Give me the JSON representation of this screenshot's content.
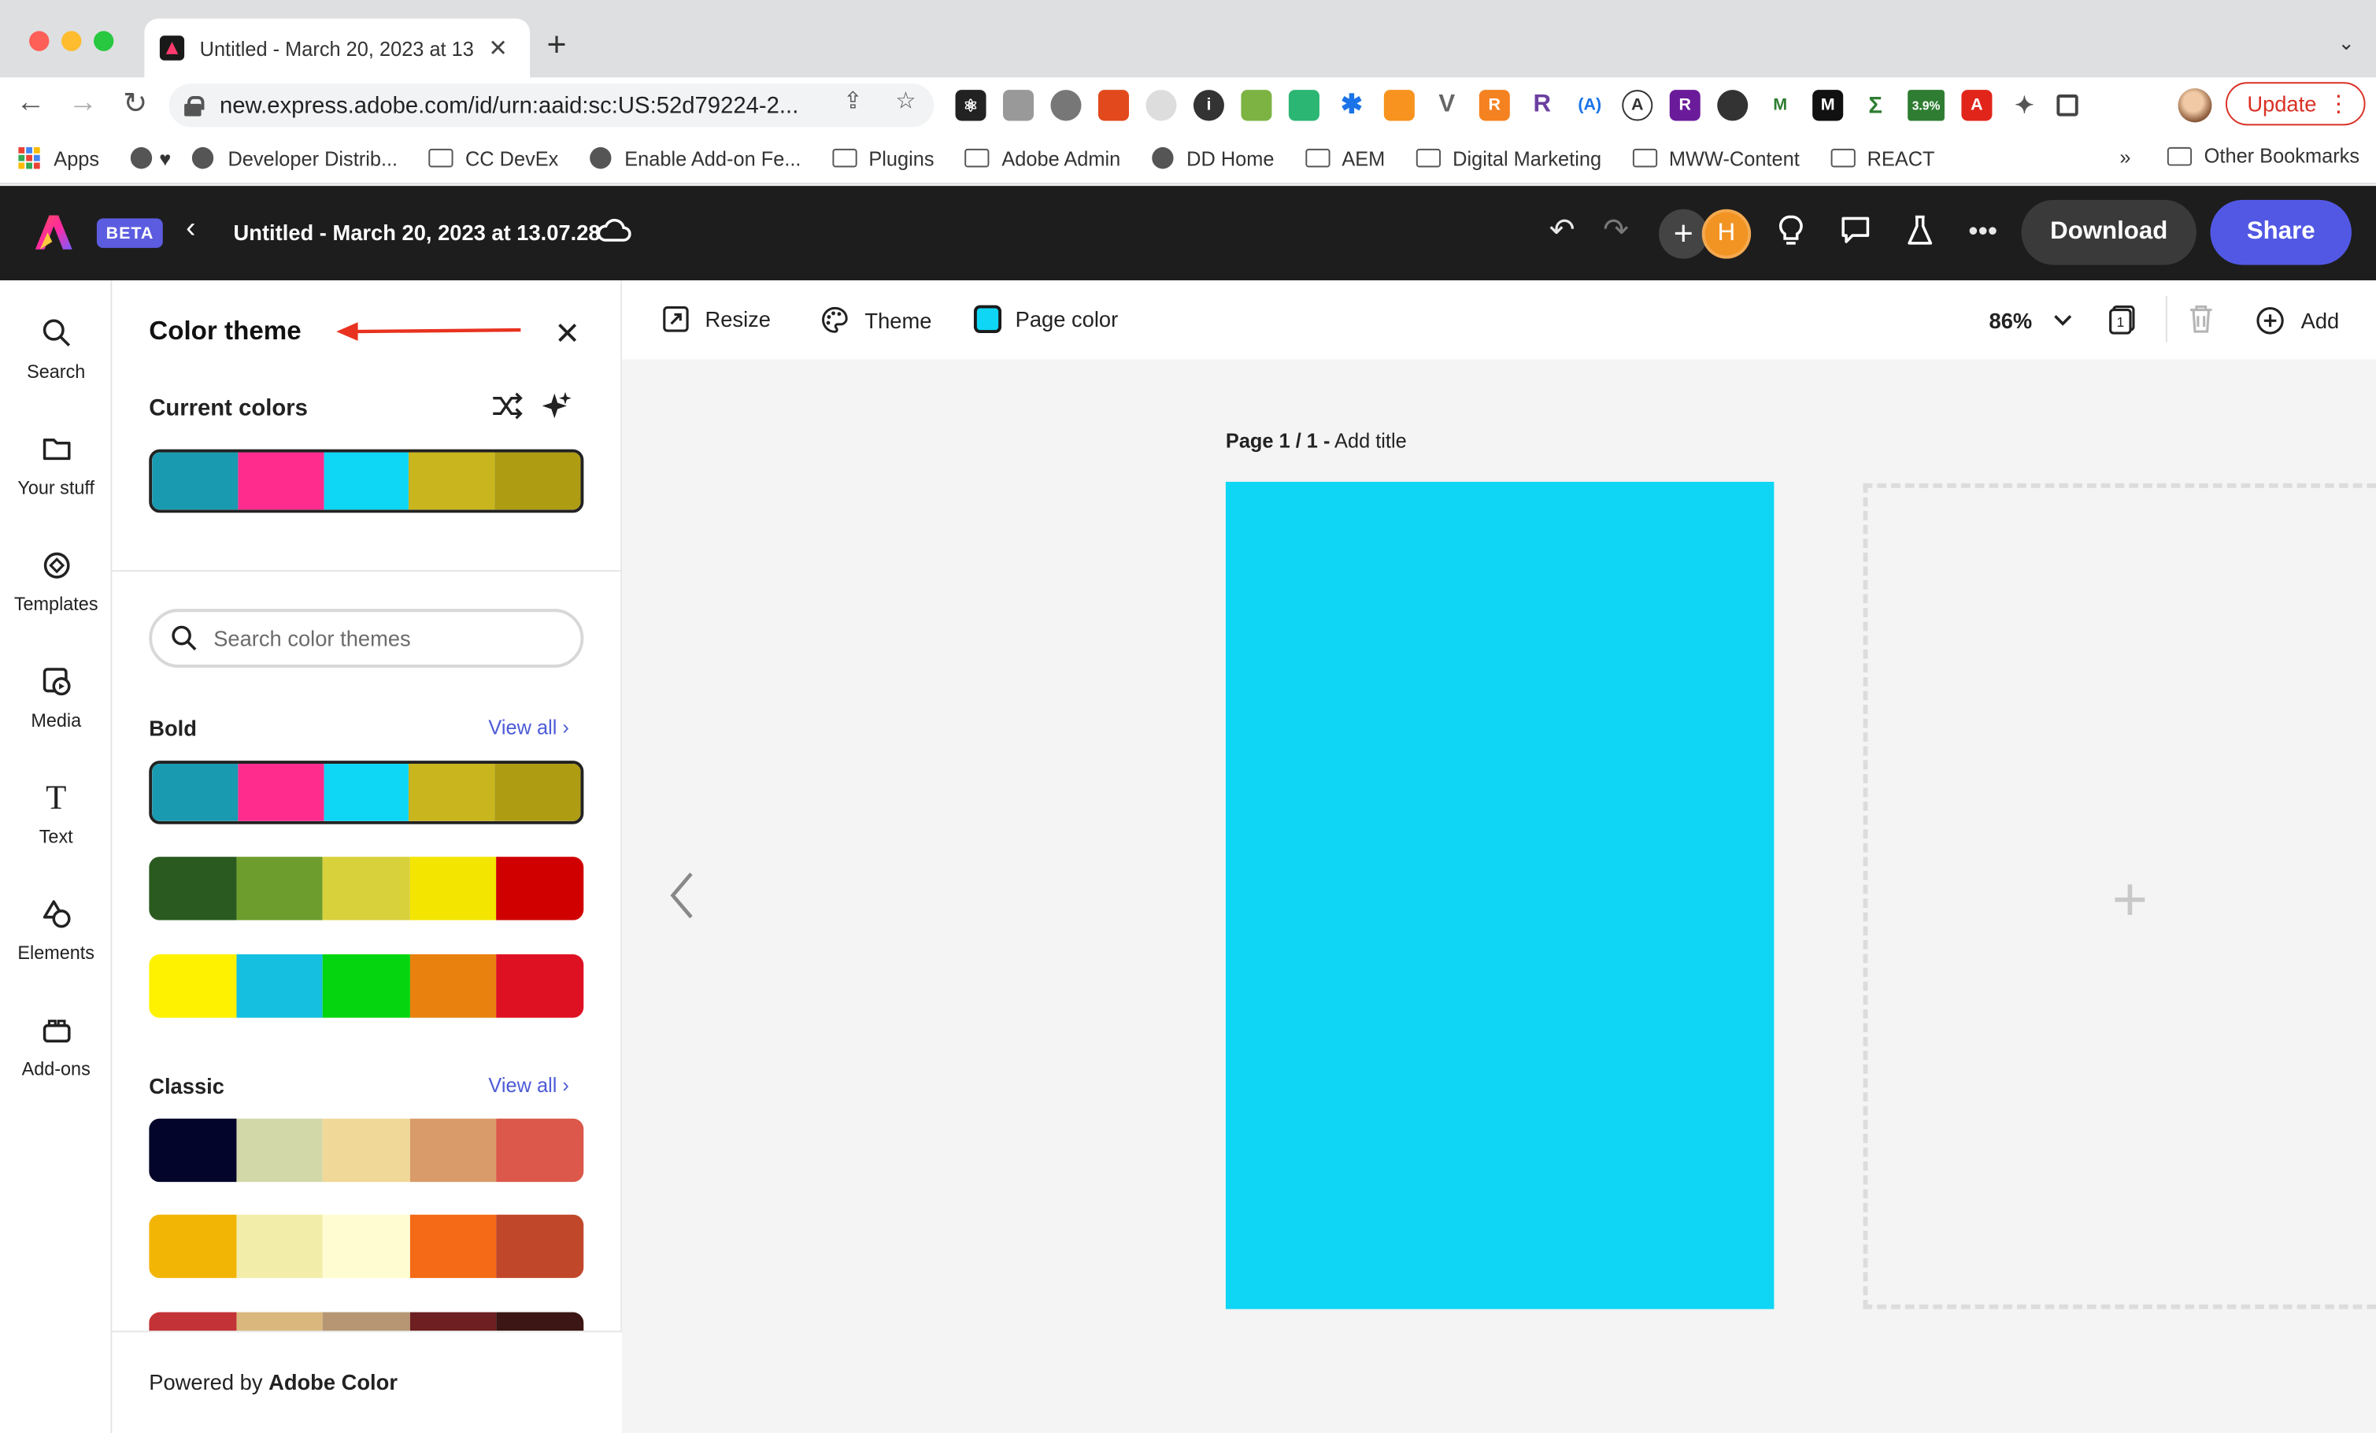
{
  "browser": {
    "tab_title": "Untitled - March 20, 2023 at 13",
    "url": "new.express.adobe.com/id/urn:aaid:sc:US:52d79224-2...",
    "update_label": "Update",
    "ext_badge": "3.9%",
    "bookmarks": [
      "Apps",
      "Developer Distrib...",
      "CC DevEx",
      "Enable Add-on Fe...",
      "Plugins",
      "Adobe Admin",
      "DD Home",
      "AEM",
      "Digital Marketing",
      "MWW-Content",
      "REACT"
    ],
    "bookmarks_more": "»",
    "other_bookmarks": "Other Bookmarks"
  },
  "app": {
    "beta": "BETA",
    "doc_title": "Untitled - March 20, 2023 at 13.07.28",
    "user_initial": "H",
    "download": "Download",
    "share": "Share"
  },
  "rail": {
    "items": [
      "Search",
      "Your stuff",
      "Templates",
      "Media",
      "Text",
      "Elements",
      "Add-ons"
    ]
  },
  "panel": {
    "title": "Color theme",
    "current_label": "Current colors",
    "current_colors": [
      "#1a9ab0",
      "#ff2c8e",
      "#0ed6f5",
      "#c9b51d",
      "#ae9c13"
    ],
    "search_placeholder": "Search color themes",
    "bold_label": "Bold",
    "classic_label": "Classic",
    "view_all": "View all",
    "bold_themes": [
      [
        "#1a9ab0",
        "#ff2c8e",
        "#0ed6f5",
        "#c9b51d",
        "#ae9c13"
      ],
      [
        "#2a5a1f",
        "#6d9d2c",
        "#d9d13c",
        "#f4e500",
        "#d00000"
      ],
      [
        "#fff200",
        "#14bfe0",
        "#05d50e",
        "#e8810d",
        "#de1122"
      ]
    ],
    "classic_themes": [
      [
        "#03062a",
        "#d3d8a9",
        "#f0d898",
        "#d99b6a",
        "#db584a"
      ],
      [
        "#f2b506",
        "#f2eda9",
        "#fffcd2",
        "#f46a16",
        "#c1472b"
      ],
      [
        "#c33236",
        "#d9b77d",
        "#b69673",
        "#6e1f22",
        "#3c1614"
      ]
    ],
    "powered_prefix": "Powered by ",
    "powered_brand": "Adobe Color"
  },
  "canvas": {
    "resize": "Resize",
    "theme": "Theme",
    "page_color": "Page color",
    "page_color_value": "#0fd6f5",
    "zoom": "86%",
    "add": "Add",
    "page_label_bold": "Page 1 / 1 -",
    "page_label_rest": " Add title"
  }
}
